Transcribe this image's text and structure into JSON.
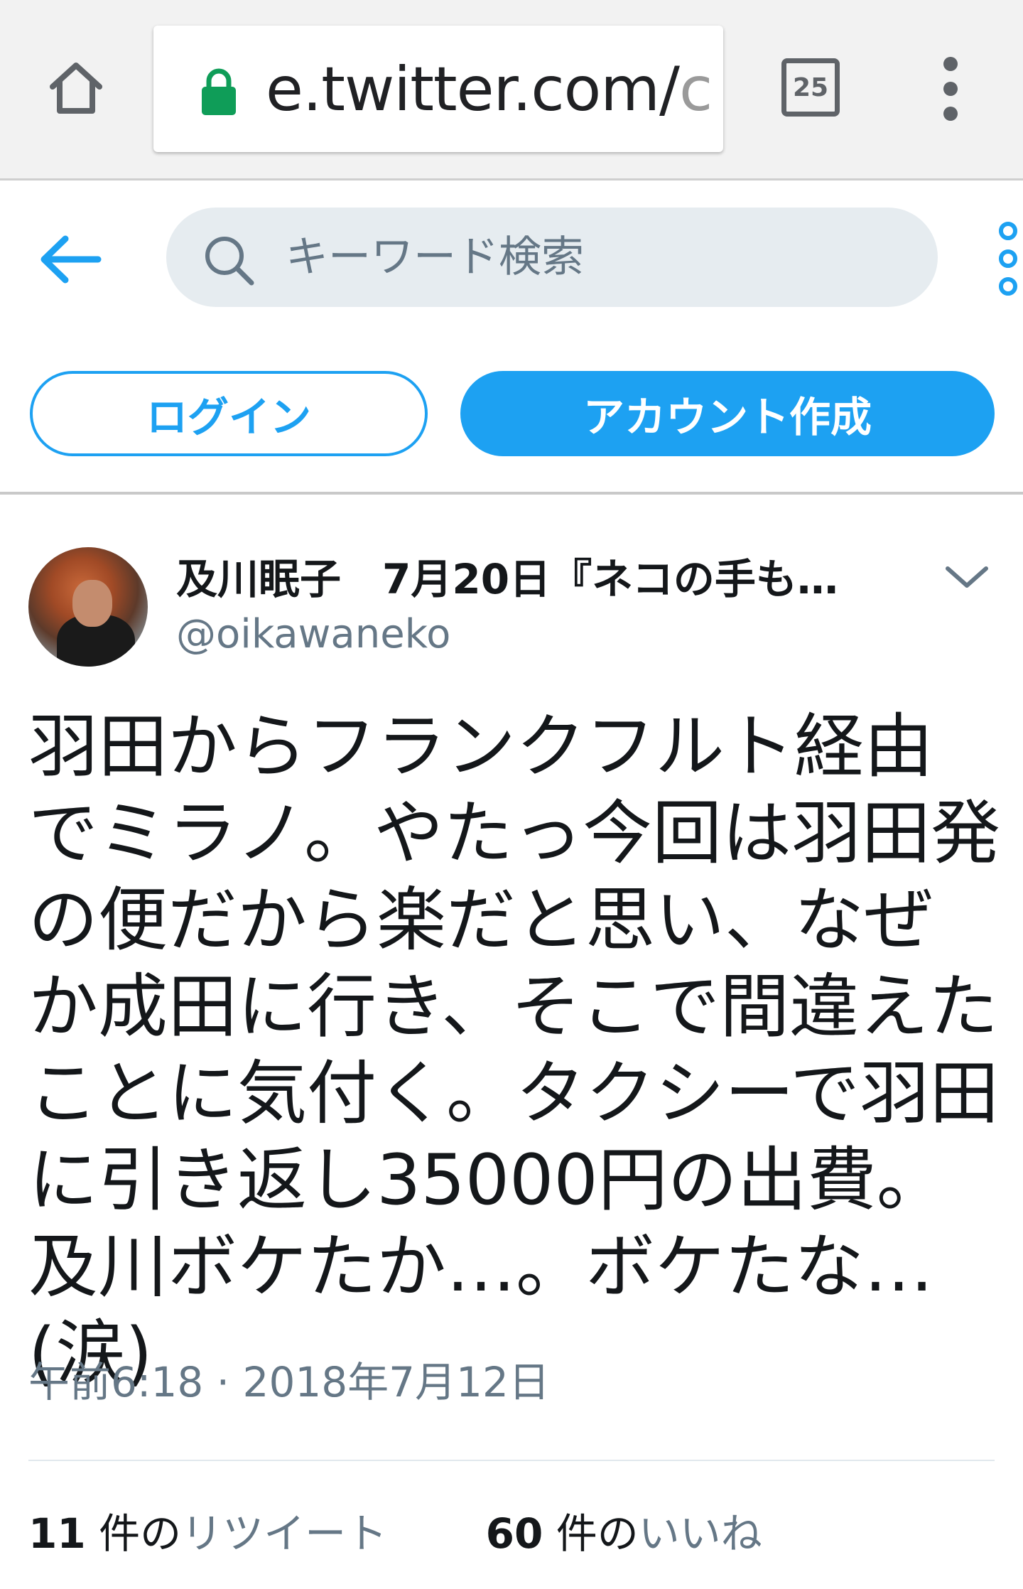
{
  "browser": {
    "url_main": "e.twitter.com/",
    "url_faded": "c",
    "tab_count": "25"
  },
  "header": {
    "search_placeholder": "キーワード検索"
  },
  "actions": {
    "login_label": "ログイン",
    "signup_label": "アカウント作成"
  },
  "tweet": {
    "display_name": "及川眠子　7月20日『ネコの手も…",
    "handle": "@oikawaneko",
    "text": "羽田からフランクフルト経由でミラノ。やたっ今回は羽田発の便だから楽だと思い、なぜか成田に行き、そこで間違えたことに気付く。タクシーで羽田に引き返し35000円の出費。及川ボケたか…。ボケたな…(涙)",
    "timestamp": "午前6:18 · 2018年7月12日",
    "retweets": {
      "count": "11",
      "prefix": "件の",
      "label": "リツイート"
    },
    "likes": {
      "count": "60",
      "prefix": "件の",
      "label": "いいね"
    }
  },
  "colors": {
    "accent": "#1da1f2",
    "secondary_text": "#657786",
    "lock": "#0f9d58"
  },
  "icons": [
    "home-icon",
    "lock-icon",
    "tab-switcher-icon",
    "more-vert-icon",
    "back-arrow-icon",
    "search-icon",
    "more-options-icon",
    "chevron-down-icon"
  ]
}
